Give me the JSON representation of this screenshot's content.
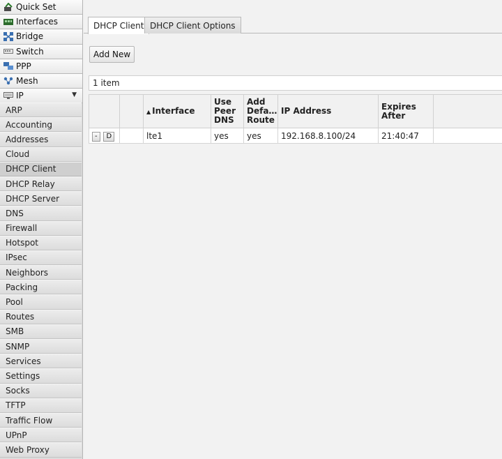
{
  "sidebar": {
    "top_items": [
      {
        "label": "Quick Set",
        "icon": "quick-set-icon"
      },
      {
        "label": "Interfaces",
        "icon": "interfaces-icon"
      },
      {
        "label": "Bridge",
        "icon": "bridge-icon"
      },
      {
        "label": "Switch",
        "icon": "switch-icon"
      },
      {
        "label": "PPP",
        "icon": "ppp-icon"
      },
      {
        "label": "Mesh",
        "icon": "mesh-icon"
      },
      {
        "label": "IP",
        "icon": "ip-icon",
        "expanded": true
      }
    ],
    "ip_submenu": [
      "ARP",
      "Accounting",
      "Addresses",
      "Cloud",
      "DHCP Client",
      "DHCP Relay",
      "DHCP Server",
      "DNS",
      "Firewall",
      "Hotspot",
      "IPsec",
      "Neighbors",
      "Packing",
      "Pool",
      "Routes",
      "SMB",
      "SNMP",
      "Services",
      "Settings",
      "Socks",
      "TFTP",
      "Traffic Flow",
      "UPnP",
      "Web Proxy"
    ],
    "active_item": "DHCP Client"
  },
  "tabs": [
    {
      "label": "DHCP Client",
      "active": true
    },
    {
      "label": "DHCP Client Options",
      "active": false
    }
  ],
  "toolbar": {
    "add_new_label": "Add New"
  },
  "item_count": "1 item",
  "table": {
    "headers": {
      "interface": "Interface",
      "use_peer_dns_1": "Use",
      "use_peer_dns_2": "Peer",
      "use_peer_dns_3": "DNS",
      "add_default_route_1": "Add",
      "add_default_route_2": "Defa…",
      "add_default_route_3": "Route",
      "ip_address": "IP Address",
      "expires_after_1": "Expires",
      "expires_after_2": "After"
    },
    "sort_indicator": "▲",
    "rows": [
      {
        "remove_label": "-",
        "flag_label": "D",
        "interface": "lte1",
        "use_peer_dns": "yes",
        "add_default_route": "yes",
        "ip_address": "192.168.8.100/24",
        "expires_after": "21:40:47"
      }
    ]
  }
}
